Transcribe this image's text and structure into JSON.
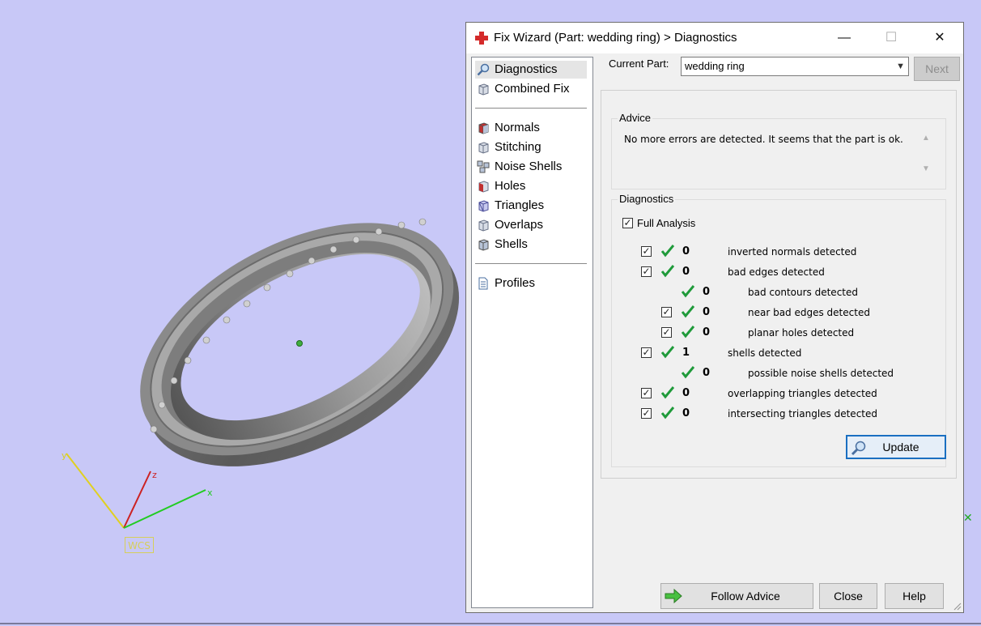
{
  "viewport": {
    "wcs_label": "WCS",
    "axis_x": "x",
    "axis_y": "y",
    "axis_z": "z",
    "background_color": "#c8c8f7"
  },
  "window": {
    "title": "Fix Wizard (Part: wedding ring) > Diagnostics",
    "minimize_glyph": "—",
    "maximize_glyph": "☐",
    "close_glyph": "✕"
  },
  "nav": {
    "items": [
      {
        "label": "Diagnostics",
        "icon": "magnifier-icon",
        "selected": true
      },
      {
        "label": "Combined Fix",
        "icon": "cube-icon"
      },
      {
        "label": "Normals",
        "icon": "normals-cube-icon"
      },
      {
        "label": "Stitching",
        "icon": "stitching-cube-icon"
      },
      {
        "label": "Noise Shells",
        "icon": "noise-shells-icon"
      },
      {
        "label": "Holes",
        "icon": "holes-cube-icon"
      },
      {
        "label": "Triangles",
        "icon": "triangles-cube-icon"
      },
      {
        "label": "Overlaps",
        "icon": "overlaps-cube-icon"
      },
      {
        "label": "Shells",
        "icon": "shells-cube-icon"
      },
      {
        "label": "Profiles",
        "icon": "document-icon"
      }
    ]
  },
  "current_part": {
    "label": "Current Part:",
    "value": "wedding ring",
    "next_label": "Next"
  },
  "advice": {
    "title": "Advice",
    "text": "No more errors are detected. It seems that the part is ok."
  },
  "diagnostics": {
    "title": "Diagnostics",
    "full_analysis_label": "Full Analysis",
    "full_analysis_checked": true,
    "rows": [
      {
        "count": "0",
        "label": "inverted normals detected",
        "checkbox": true,
        "indent": 0
      },
      {
        "count": "0",
        "label": "bad edges detected",
        "checkbox": true,
        "indent": 0
      },
      {
        "count": "0",
        "label": "bad contours detected",
        "checkbox": false,
        "indent": 1
      },
      {
        "count": "0",
        "label": "near bad edges detected",
        "checkbox": true,
        "indent": 1
      },
      {
        "count": "0",
        "label": "planar holes detected",
        "checkbox": true,
        "indent": 1
      },
      {
        "count": "1",
        "label": "shells detected",
        "checkbox": true,
        "indent": 0
      },
      {
        "count": "0",
        "label": "possible noise shells detected",
        "checkbox": false,
        "indent": 1
      },
      {
        "count": "0",
        "label": "overlapping triangles detected",
        "checkbox": true,
        "indent": 0
      },
      {
        "count": "0",
        "label": "intersecting triangles detected",
        "checkbox": true,
        "indent": 0
      }
    ],
    "update_label": "Update"
  },
  "footer": {
    "follow_advice_label": "Follow Advice",
    "close_label": "Close",
    "help_label": "Help"
  },
  "colors": {
    "check_green": "#1f9a3a",
    "accent_blue": "#1a6fc1"
  }
}
